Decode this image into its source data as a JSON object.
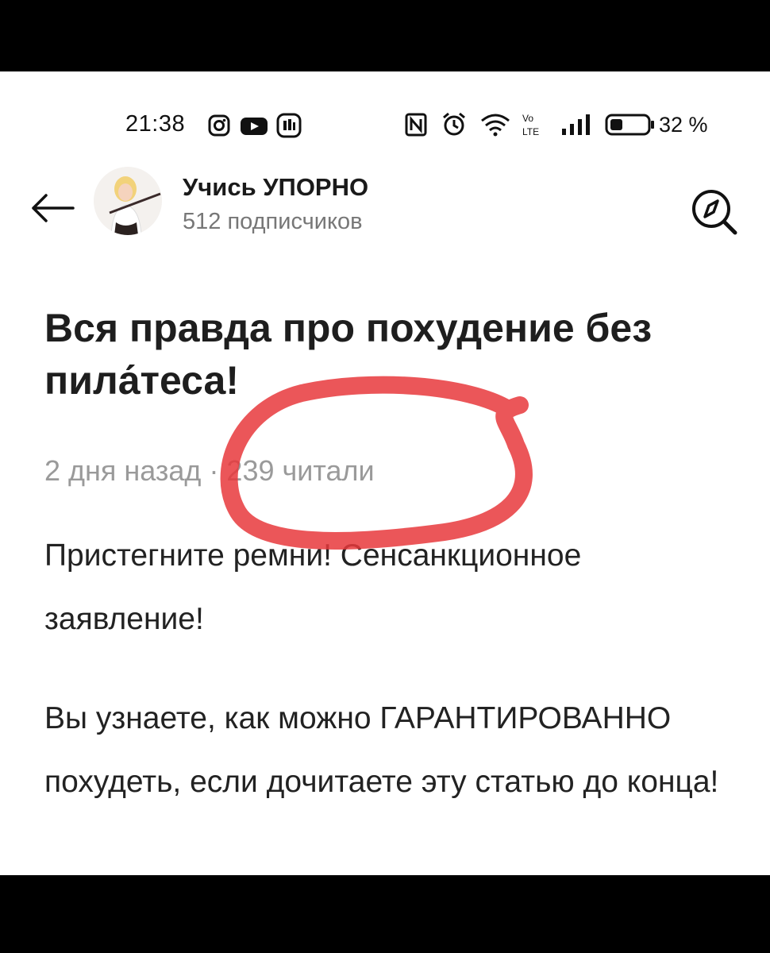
{
  "status_bar": {
    "time": "21:38",
    "battery": "32 %",
    "icons": [
      "instagram-icon",
      "youtube-icon",
      "messenger-icon",
      "nfc-icon",
      "alarm-icon",
      "wifi-icon",
      "volte-icon",
      "signal-icon",
      "battery-icon"
    ]
  },
  "header": {
    "channel_name": "Учись УПОРНО",
    "subscribers": "512 подписчиков"
  },
  "article": {
    "title": "Вся правда про похудение без пила́теса!",
    "meta": "2 дня назад · 239 читали",
    "paragraph1": "Пристегните ремни! Сенсанкционное заявление!",
    "paragraph2": "Вы узнаете, как можно ГАРАНТИРОВАННО похудеть, если дочитаете эту статью до конца!"
  },
  "colors": {
    "highlight": "#e8383c",
    "text": "#1e1e1e",
    "muted": "#9a9a9a"
  }
}
